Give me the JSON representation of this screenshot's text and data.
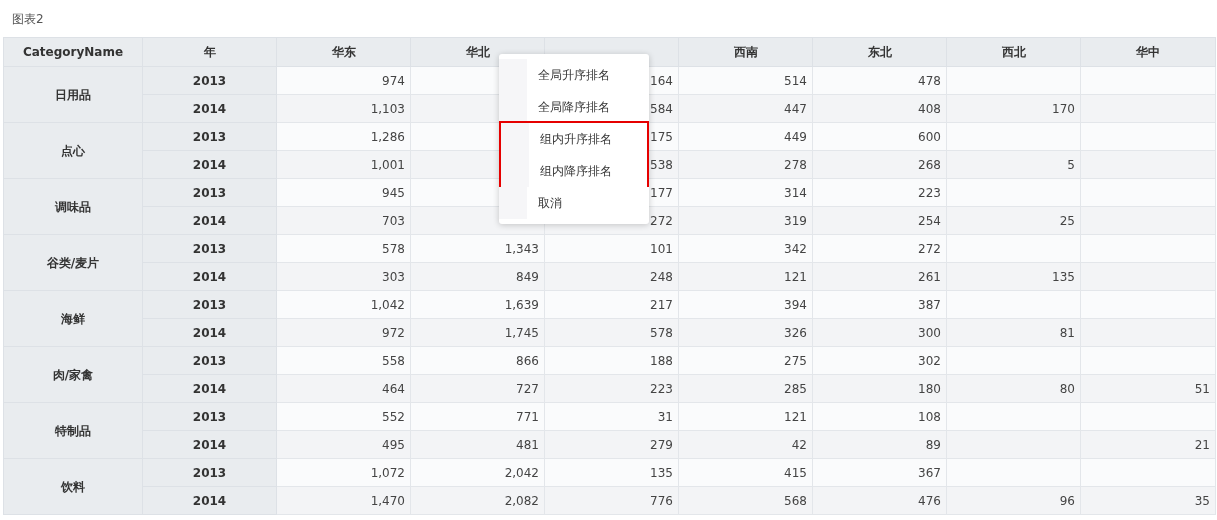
{
  "title": "图表2",
  "columns": [
    {
      "label": "CategoryName"
    },
    {
      "label": "年"
    },
    {
      "label": "华东"
    },
    {
      "label": "华北"
    },
    {},
    {
      "label": "西南"
    },
    {
      "label": "东北"
    },
    {
      "label": "西北"
    },
    {
      "label": "华中"
    }
  ],
  "groups": [
    {
      "name": "日用品",
      "rows": [
        {
          "year": "2013",
          "cells": [
            "974",
            null,
            "164",
            "514",
            "478",
            null,
            null
          ]
        },
        {
          "year": "2014",
          "cells": [
            "1,103",
            null,
            "584",
            "447",
            "408",
            "170",
            null
          ]
        }
      ]
    },
    {
      "name": "点心",
      "rows": [
        {
          "year": "2013",
          "cells": [
            "1,286",
            null,
            "175",
            "449",
            "600",
            null,
            null
          ]
        },
        {
          "year": "2014",
          "cells": [
            "1,001",
            null,
            "538",
            "278",
            "268",
            "5",
            null
          ]
        }
      ]
    },
    {
      "name": "调味品",
      "rows": [
        {
          "year": "2013",
          "cells": [
            "945",
            null,
            "177",
            "314",
            "223",
            null,
            null
          ]
        },
        {
          "year": "2014",
          "cells": [
            "703",
            null,
            "272",
            "319",
            "254",
            "25",
            null
          ]
        }
      ]
    },
    {
      "name": "谷类/麦片",
      "rows": [
        {
          "year": "2013",
          "cells": [
            "578",
            "1,343",
            "101",
            "342",
            "272",
            null,
            null
          ]
        },
        {
          "year": "2014",
          "cells": [
            "303",
            "849",
            "248",
            "121",
            "261",
            "135",
            null
          ]
        }
      ]
    },
    {
      "name": "海鲜",
      "rows": [
        {
          "year": "2013",
          "cells": [
            "1,042",
            "1,639",
            "217",
            "394",
            "387",
            null,
            null
          ]
        },
        {
          "year": "2014",
          "cells": [
            "972",
            "1,745",
            "578",
            "326",
            "300",
            "81",
            null
          ]
        }
      ]
    },
    {
      "name": "肉/家禽",
      "rows": [
        {
          "year": "2013",
          "cells": [
            "558",
            "866",
            "188",
            "275",
            "302",
            null,
            null
          ]
        },
        {
          "year": "2014",
          "cells": [
            "464",
            "727",
            "223",
            "285",
            "180",
            "80",
            "51"
          ]
        }
      ]
    },
    {
      "name": "特制品",
      "rows": [
        {
          "year": "2013",
          "cells": [
            "552",
            "771",
            "31",
            "121",
            "108",
            null,
            null
          ]
        },
        {
          "year": "2014",
          "cells": [
            "495",
            "481",
            "279",
            "42",
            "89",
            null,
            "21"
          ]
        }
      ]
    },
    {
      "name": "饮料",
      "rows": [
        {
          "year": "2013",
          "cells": [
            "1,072",
            "2,042",
            "135",
            "415",
            "367",
            null,
            null
          ]
        },
        {
          "year": "2014",
          "cells": [
            "1,470",
            "2,082",
            "776",
            "568",
            "476",
            "96",
            "35"
          ]
        }
      ]
    }
  ],
  "context_menu": {
    "items": [
      {
        "label": "全局升序排名",
        "highlighted": false
      },
      {
        "label": "全局降序排名",
        "highlighted": false
      },
      {
        "label": "组内升序排名",
        "highlighted": true
      },
      {
        "label": "组内降序排名",
        "highlighted": true
      },
      {
        "label": "取消",
        "highlighted": false
      }
    ]
  }
}
